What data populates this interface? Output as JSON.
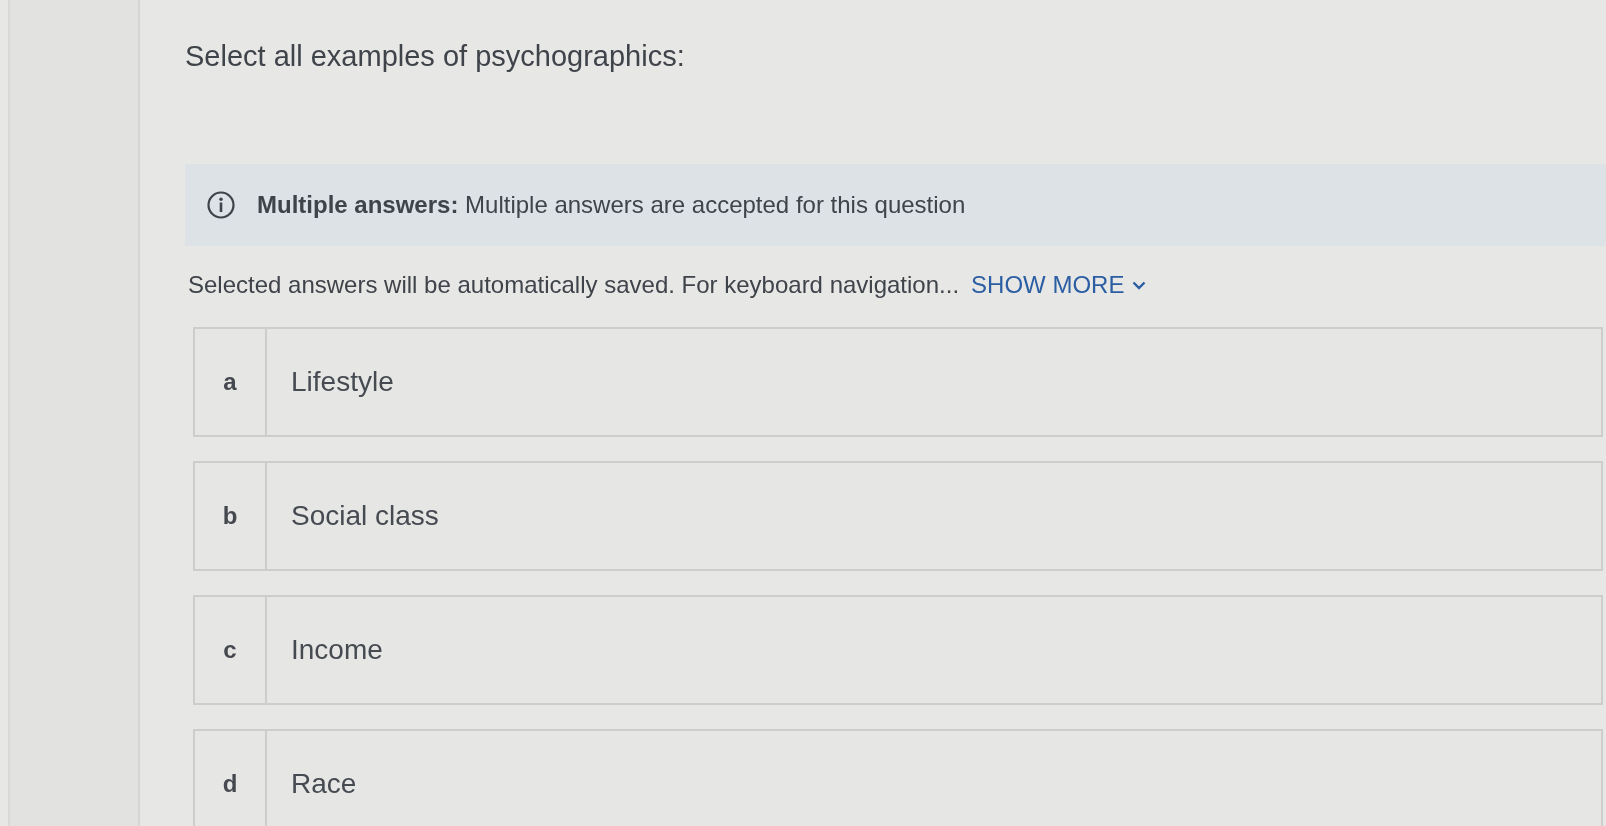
{
  "question": {
    "prompt": "Select all examples of psychographics:"
  },
  "notice": {
    "kind": "info",
    "text": "**Multiple answers:**  Multiple answers are accepted for this question"
  },
  "instructions": {
    "text": "Selected answers will be automatically saved. For keyboard navigation...",
    "show_more": {
      "label": "SHOW MORE",
      "expanded": false
    }
  },
  "options": [
    {
      "letter": "a",
      "label": "Lifestyle",
      "selected": false
    },
    {
      "letter": "b",
      "label": "Social class",
      "selected": false
    },
    {
      "letter": "c",
      "label": "Income",
      "selected": false
    },
    {
      "letter": "d",
      "label": "Race",
      "selected": false
    }
  ]
}
